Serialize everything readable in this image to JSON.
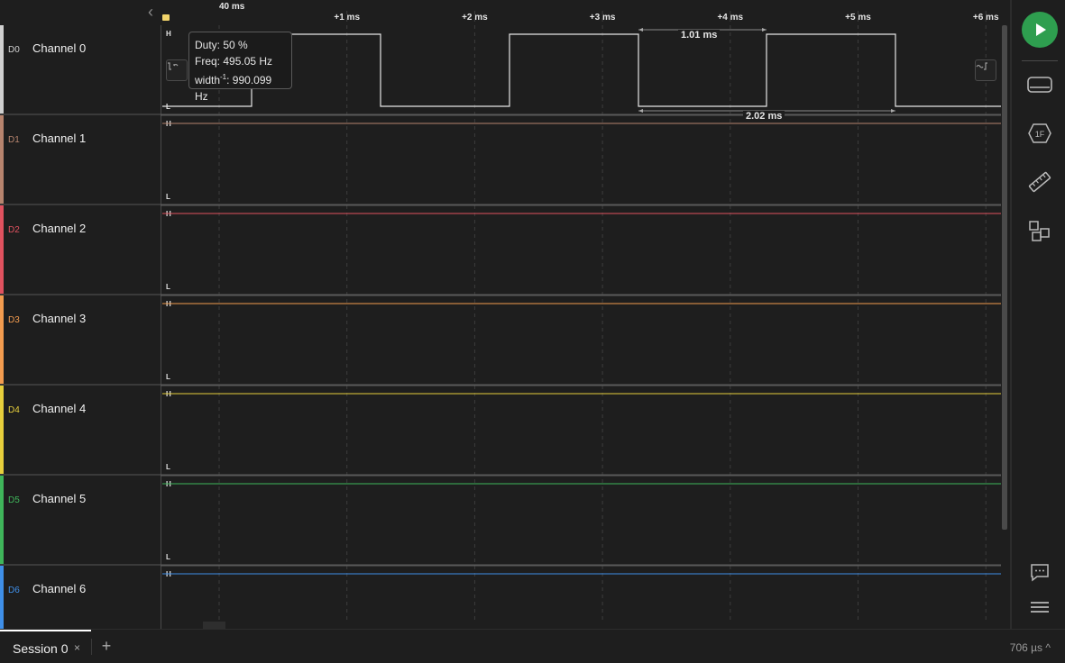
{
  "timeline": {
    "origin_label": "40 ms",
    "ticks": [
      "+1 ms",
      "+2 ms",
      "+3 ms",
      "+4 ms",
      "+5 ms",
      "+6 ms"
    ]
  },
  "channels": [
    {
      "code": "D0",
      "name": "Channel 0",
      "color": "#d0d0d0"
    },
    {
      "code": "D1",
      "name": "Channel 1",
      "color": "#b7846e"
    },
    {
      "code": "D2",
      "name": "Channel 2",
      "color": "#e0525f"
    },
    {
      "code": "D3",
      "name": "Channel 3",
      "color": "#f39c4f"
    },
    {
      "code": "D4",
      "name": "Channel 4",
      "color": "#e7cf3c"
    },
    {
      "code": "D5",
      "name": "Channel 5",
      "color": "#3fb55a"
    },
    {
      "code": "D6",
      "name": "Channel 6",
      "color": "#3f8fe8"
    }
  ],
  "level_labels": {
    "high": "H",
    "low": "L"
  },
  "tooltip": {
    "duty": "Duty: 50 %",
    "freq": "Freq: 495.05 Hz",
    "width_prefix": "width",
    "width_sup": "-1",
    "width_value": ": 990.099 Hz"
  },
  "measurements": {
    "pulse_width": "1.01 ms",
    "period": "2.02 ms"
  },
  "sidebar": {
    "play_icon": "play-icon",
    "buttons": [
      "device-icon",
      "analyzer-icon",
      "measure-icon",
      "extensions-icon"
    ],
    "bottom_buttons": [
      "notes-icon",
      "menu-icon"
    ]
  },
  "tabs": {
    "session": "Session 0",
    "close": "×",
    "add": "+",
    "status": "706 µs ^"
  }
}
